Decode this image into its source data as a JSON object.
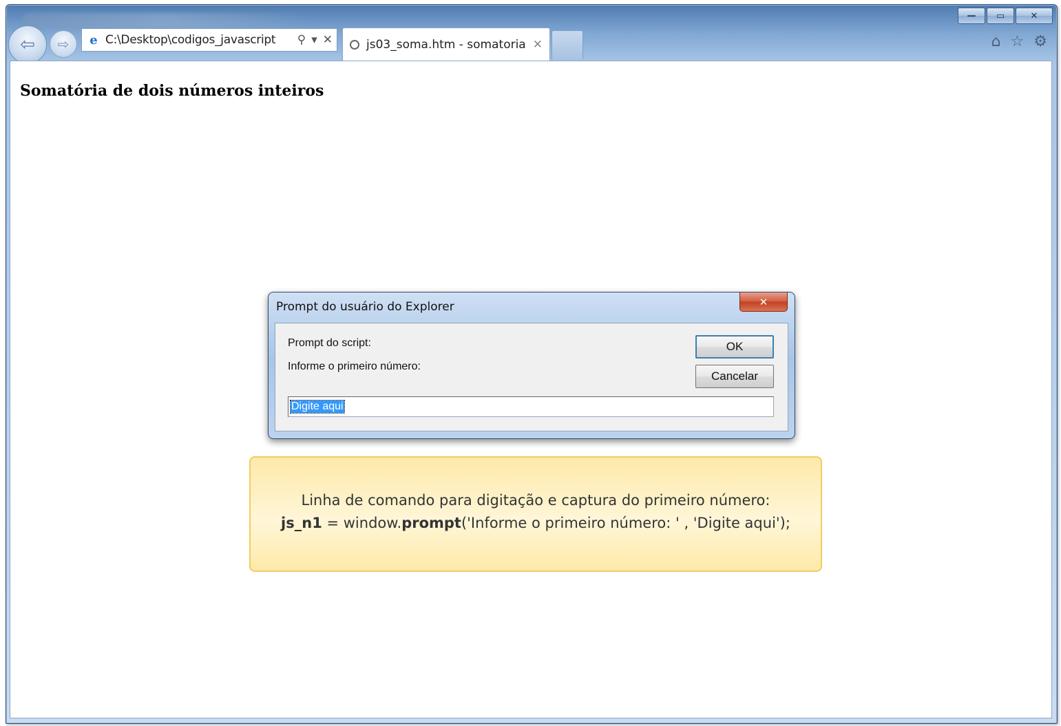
{
  "browser": {
    "address": "C:\\Desktop\\codigos_javascript",
    "tab_title": "js03_soma.htm - somatoria",
    "address_icons": [
      "search-icon",
      "dropdown-arrow-icon",
      "stop-icon"
    ],
    "toolbar_icons": [
      "home-icon",
      "favorites-star-icon",
      "settings-gear-icon"
    ],
    "window_controls": [
      "minimize",
      "maximize",
      "close"
    ]
  },
  "page": {
    "title": "Somatória de dois números inteiros"
  },
  "dialog": {
    "title": "Prompt do usuário do Explorer",
    "label_script": "Prompt do script:",
    "label_message": "Informe o primeiro número:",
    "ok_label": "OK",
    "cancel_label": "Cancelar",
    "input_value": "Digite aqui"
  },
  "callout": {
    "line1": "Linha de comando para digitação e captura do primeiro número:",
    "line2_var": "js_n1",
    "line2_eq": " = window.",
    "line2_fn": "prompt",
    "line2_args": "('Informe o primeiro número: ' , 'Digite aqui');"
  },
  "colors": {
    "selection": "#3399ff",
    "callout_bg": "#fff6d8",
    "callout_border": "#f3cb62",
    "dialog_close": "#c2401f"
  }
}
